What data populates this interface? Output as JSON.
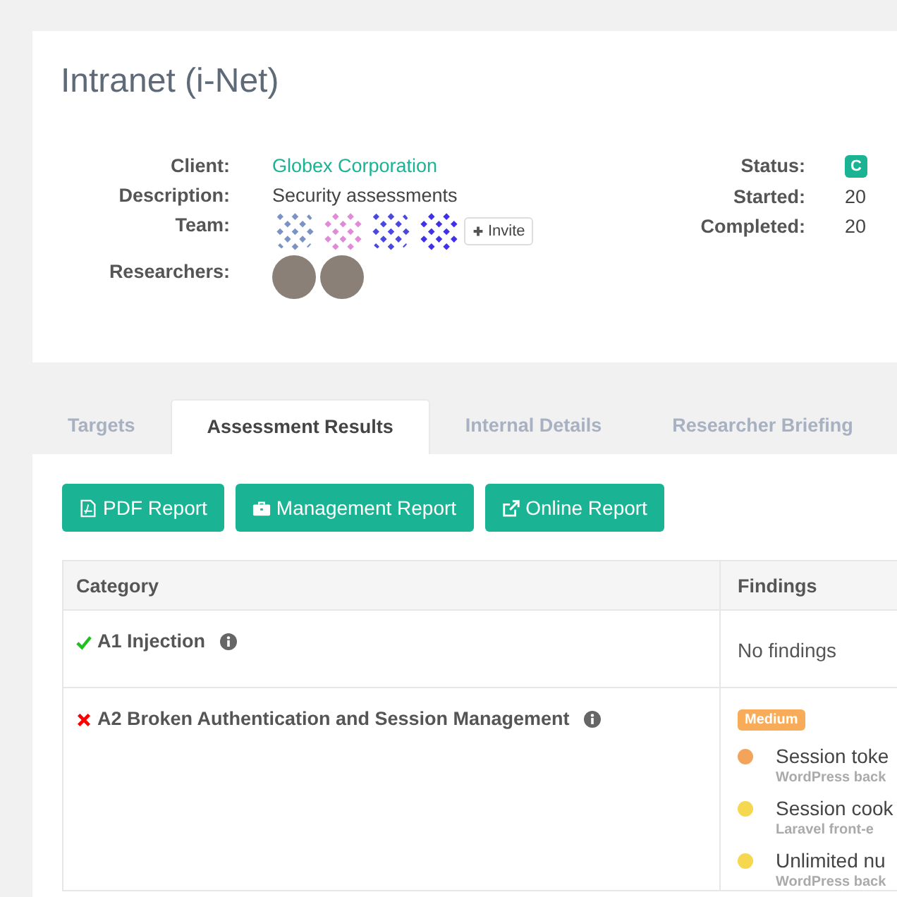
{
  "project": {
    "title": "Intranet (i-Net)",
    "client": {
      "label": "Client:",
      "value": "Globex Corporation"
    },
    "description": {
      "label": "Description:",
      "value": "Security assessments"
    },
    "team": {
      "label": "Team:",
      "members": [
        {
          "color": "#7b93c4"
        },
        {
          "color": "#e08ad8"
        },
        {
          "color": "#4b48e0"
        },
        {
          "color": "#4030e8"
        }
      ],
      "invite": "Invite"
    },
    "researchers": {
      "label": "Researchers:",
      "people": [
        {
          "photo": true
        },
        {
          "photo": true
        }
      ]
    },
    "status": {
      "label": "Status:",
      "value": "C"
    },
    "started": {
      "label": "Started:",
      "value": "20"
    },
    "completed": {
      "label": "Completed:",
      "value": "20"
    }
  },
  "tabs": [
    {
      "label": "Targets",
      "selected": false
    },
    {
      "label": "Assessment Results",
      "selected": true
    },
    {
      "label": "Internal Details",
      "selected": false
    },
    {
      "label": "Researcher Briefing",
      "selected": false
    }
  ],
  "buttons": [
    {
      "label": "PDF Report",
      "kind": "pdf"
    },
    {
      "label": "Management Report",
      "kind": "briefcase"
    },
    {
      "label": "Online Report",
      "kind": "external"
    }
  ],
  "table": {
    "columns": [
      "Category",
      "Findings"
    ],
    "rows": [
      {
        "category": "A1 Injection",
        "passed": true,
        "empty_text": "No findings"
      },
      {
        "category": "A2 Broken Authentication and Session Management",
        "passed": false,
        "severity": "Medium",
        "findings": [
          {
            "title": "Session toke",
            "target": "WordPress back",
            "color": "#f4a35a"
          },
          {
            "title": "Session cook",
            "target": "Laravel front-e",
            "color": "#f5d84f"
          },
          {
            "title": "Unlimited nu",
            "target": "WordPress back",
            "color": "#f5d84f"
          }
        ]
      }
    ]
  }
}
